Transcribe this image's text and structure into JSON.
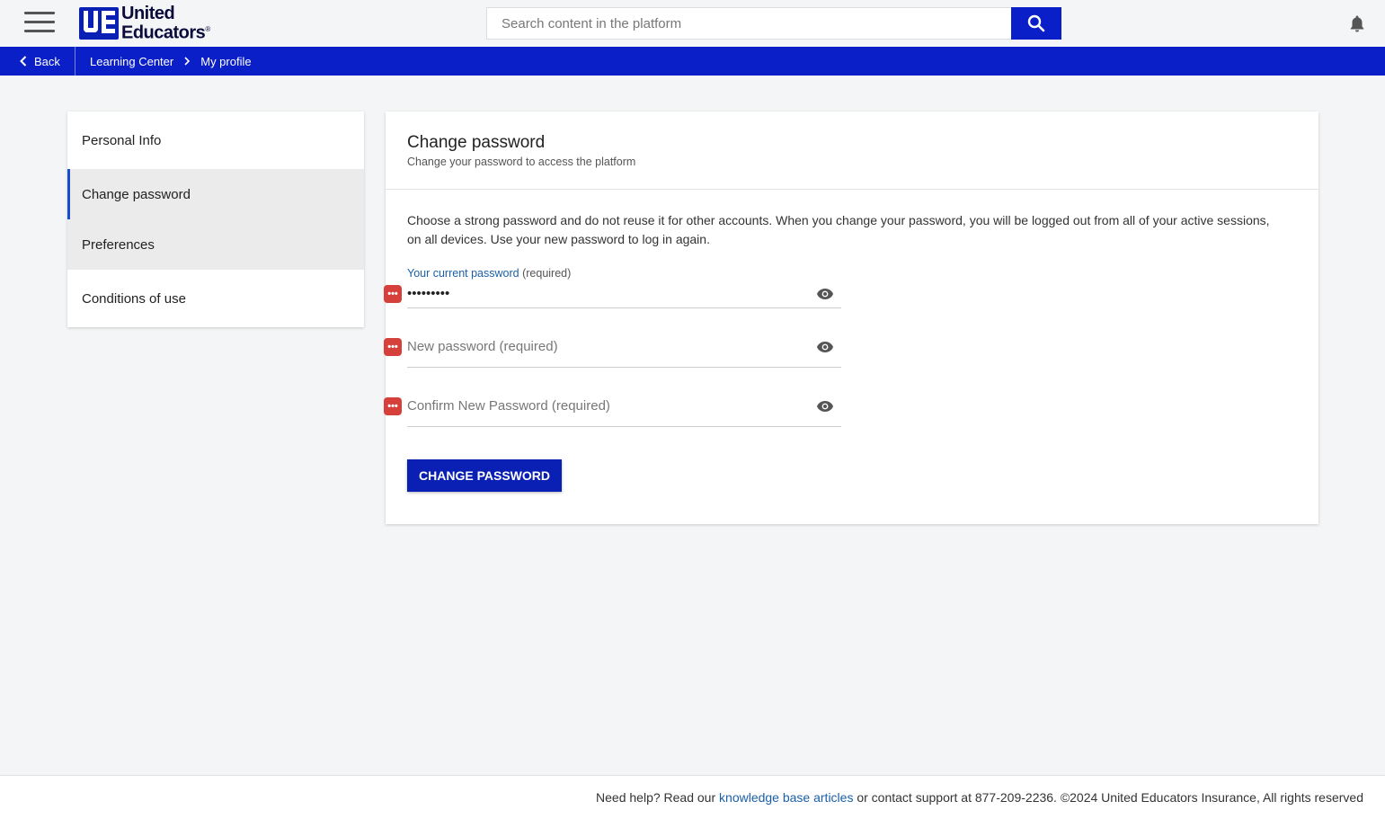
{
  "header": {
    "logo_line1": "United",
    "logo_line2": "Educators",
    "logo_reg": "®",
    "search_placeholder": "Search content in the platform"
  },
  "breadcrumb": {
    "back_label": "Back",
    "items": [
      "Learning Center",
      "My profile"
    ]
  },
  "sidebar": {
    "items": [
      {
        "label": "Personal Info"
      },
      {
        "label": "Change password"
      },
      {
        "label": "Preferences"
      },
      {
        "label": "Conditions of use"
      }
    ],
    "active": "Change password"
  },
  "main": {
    "title": "Change password",
    "subtitle": "Change your password to access the platform",
    "description": "Choose a strong password and do not reuse it for other accounts. When you change your password, you will be logged out from all of your active sessions, on all devices. Use your new password to log in again.",
    "current_label": "Your current password",
    "current_required": "(required)",
    "current_value": "•••••••••",
    "new_placeholder": "New password (required)",
    "confirm_placeholder": "Confirm New Password (required)",
    "submit_label": "CHANGE PASSWORD"
  },
  "footer": {
    "prefix": "Need help? Read our",
    "link": "knowledge base articles",
    "suffix": "or contact support at 877-209-2236. ©2024 United Educators Insurance, All rights reserved"
  },
  "colors": {
    "brand_blue": "#0a1fc7",
    "link_blue": "#1a5fa8",
    "password_manager_red": "#d6403b"
  }
}
